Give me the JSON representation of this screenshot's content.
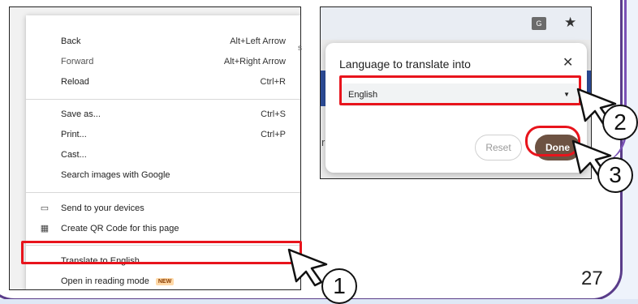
{
  "page_number": "27",
  "context_menu": {
    "items": [
      {
        "label": "Back",
        "shortcut": "Alt+Left Arrow"
      },
      {
        "label": "Forward",
        "shortcut": "Alt+Right Arrow"
      },
      {
        "label": "Reload",
        "shortcut": "Ctrl+R"
      },
      {
        "label": "Save as...",
        "shortcut": "Ctrl+S"
      },
      {
        "label": "Print...",
        "shortcut": "Ctrl+P"
      },
      {
        "label": "Cast..."
      },
      {
        "label": "Search images with Google"
      },
      {
        "label": "Send to your devices"
      },
      {
        "label": "Create QR Code for this page"
      },
      {
        "label": "Translate to English"
      },
      {
        "label": "Open in reading mode",
        "badge": "NEW"
      }
    ]
  },
  "translate_dialog": {
    "title": "Language to translate into",
    "close_glyph": "✕",
    "language_value": "English",
    "reset_label": "Reset",
    "done_label": "Done"
  },
  "toolbar": {
    "translate_icon": "translate-icon",
    "star_icon": "star-icon"
  },
  "steps": [
    "1",
    "2",
    "3"
  ],
  "colors": {
    "highlight": "#e8141c",
    "done_button": "#6d5242",
    "frame": "#5a3d8a"
  }
}
